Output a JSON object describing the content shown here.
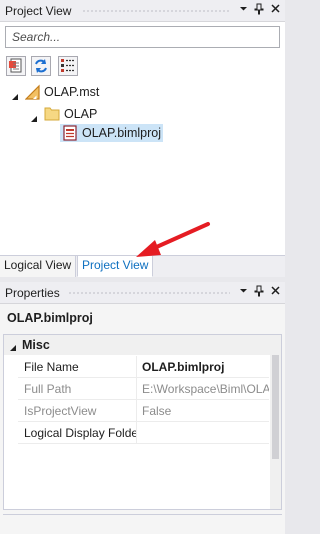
{
  "project_view": {
    "title": "Project View",
    "search": {
      "placeholder": "Search...",
      "value": ""
    },
    "tree": {
      "root": {
        "label": "OLAP.mst",
        "expanded": true
      },
      "folder": {
        "label": "OLAP",
        "expanded": true
      },
      "file": {
        "label": "OLAP.bimlproj",
        "selected": true
      }
    }
  },
  "tabs": [
    {
      "label": "Logical View",
      "active": false
    },
    {
      "label": "Project View",
      "active": true
    }
  ],
  "properties": {
    "title": "Properties",
    "object_name": "OLAP.bimlproj",
    "category": {
      "label": "Misc",
      "expanded": true
    },
    "rows": [
      {
        "name": "File Name",
        "value": "OLAP.bimlproj",
        "readonly": false
      },
      {
        "name": "Full Path",
        "value": "E:\\Workspace\\Biml\\OLAP",
        "readonly": true
      },
      {
        "name": "IsProjectView",
        "value": "False",
        "readonly": true
      },
      {
        "name": "Logical Display Folder",
        "value": "",
        "readonly": false
      }
    ]
  },
  "colors": {
    "accent": "#0e70c0",
    "annotation_arrow": "#e51c23"
  }
}
